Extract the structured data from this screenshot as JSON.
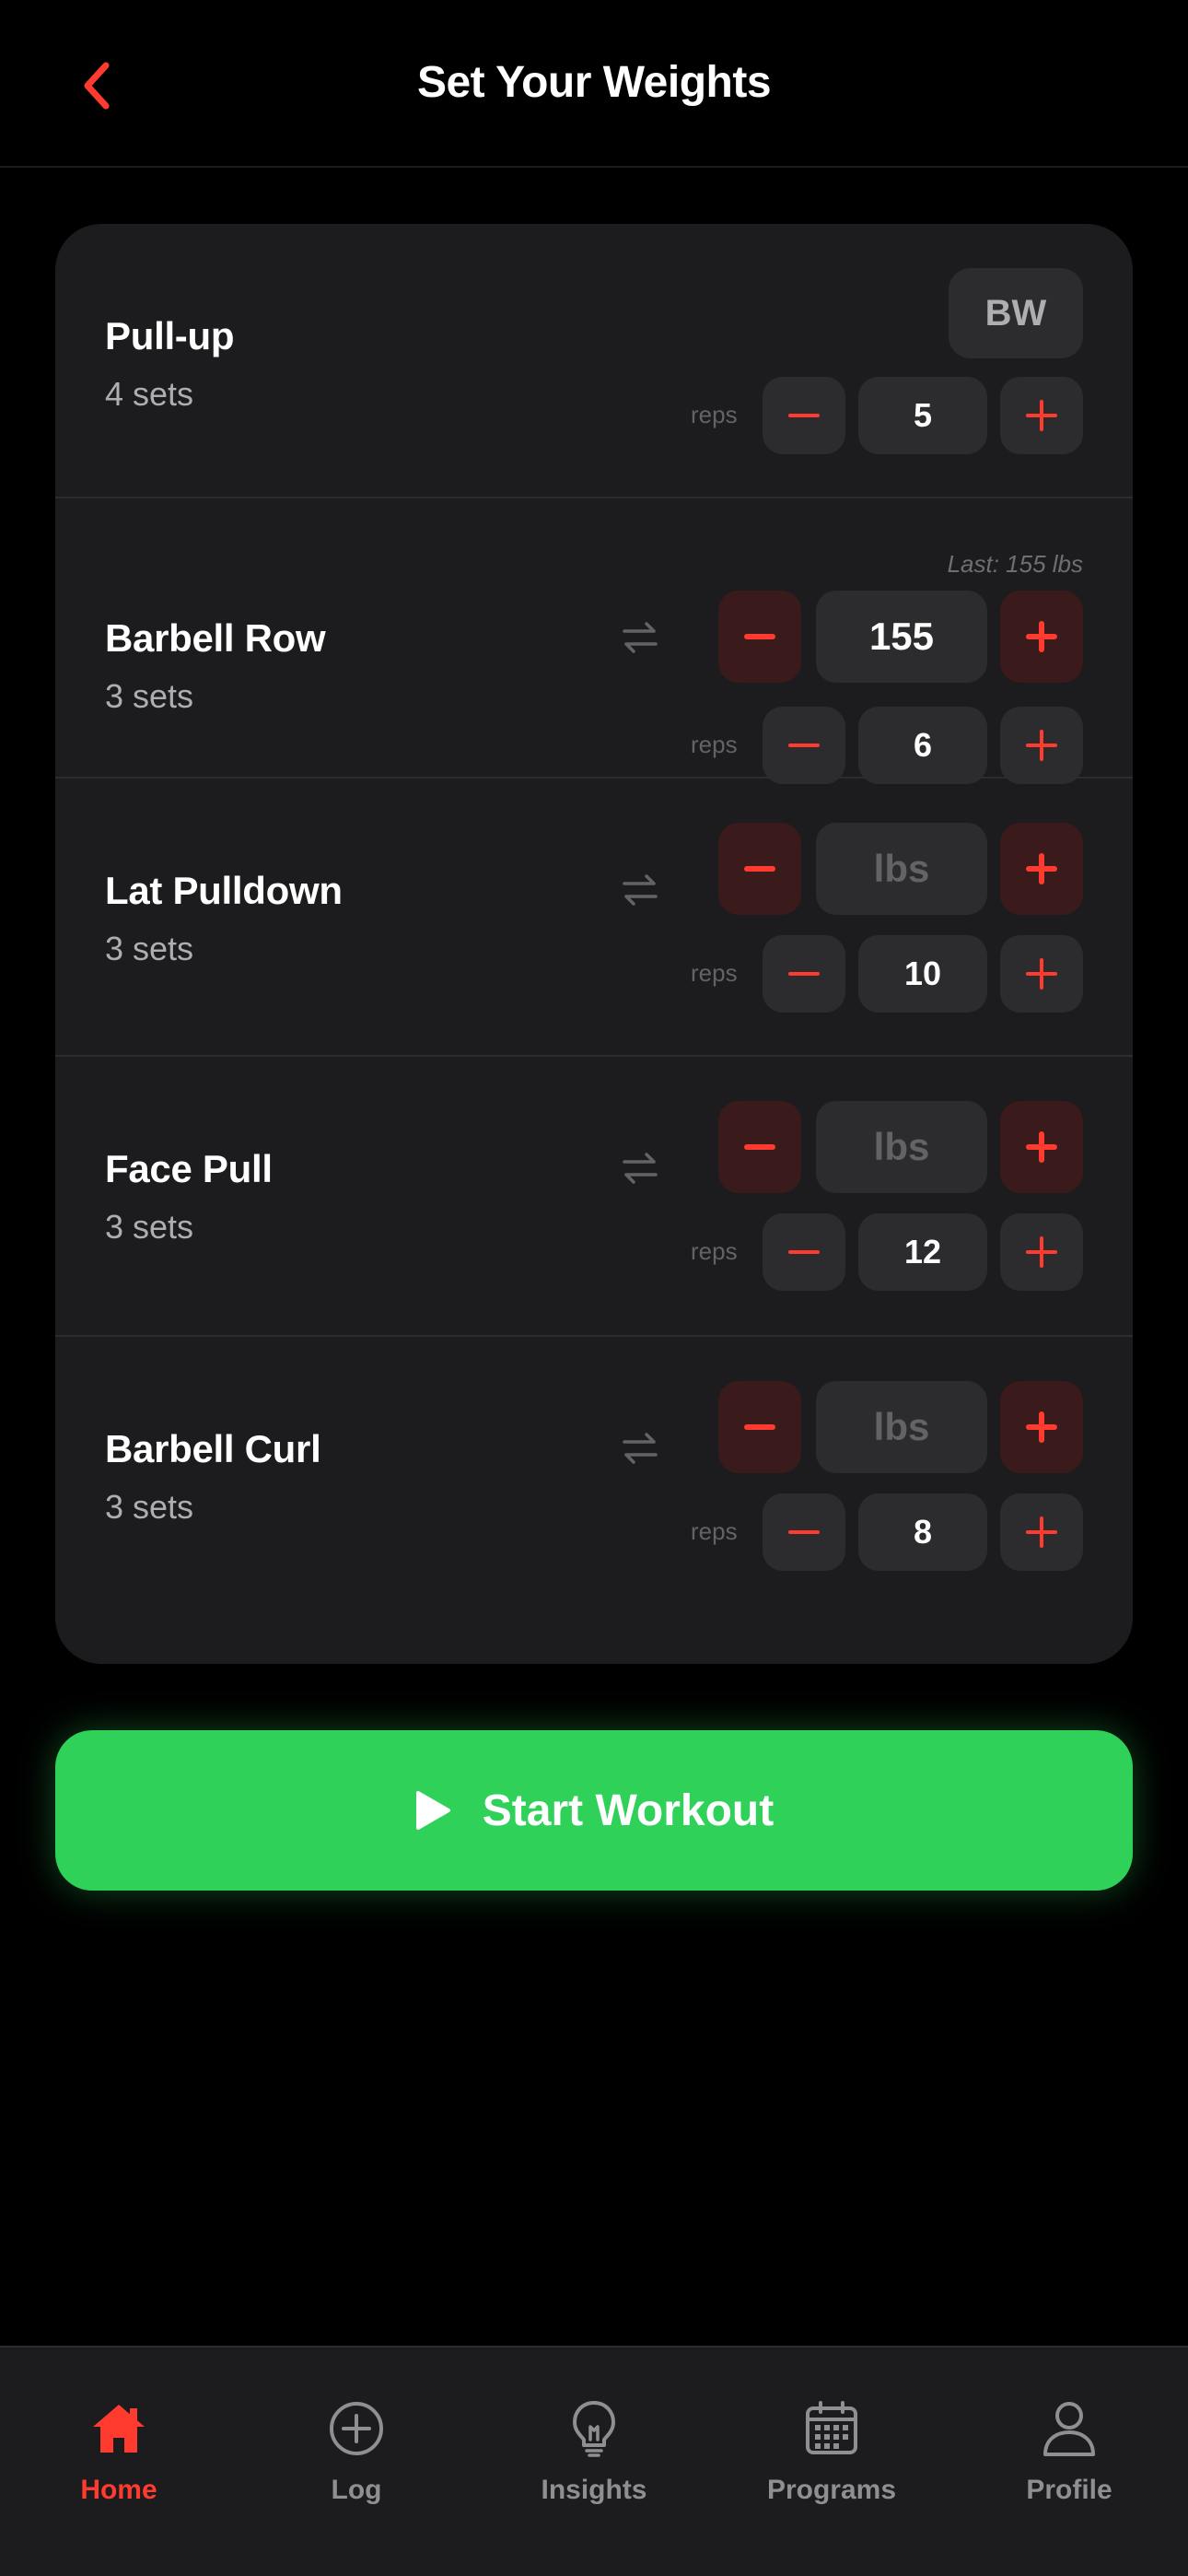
{
  "header": {
    "title": "Set Your Weights"
  },
  "colors": {
    "accent": "#ff3b30",
    "start": "#30d158",
    "card": "#1c1c1e"
  },
  "exercises": [
    {
      "name": "Pull-up",
      "sets": "4 sets",
      "weight": "BW",
      "reps_label": "reps",
      "reps": "5"
    },
    {
      "name": "Barbell Row",
      "sets": "3 sets",
      "last": "Last: 155 lbs",
      "weight": "155",
      "reps_label": "reps",
      "reps": "6"
    },
    {
      "name": "Lat Pulldown",
      "sets": "3 sets",
      "weight_placeholder": "lbs",
      "reps_label": "reps",
      "reps": "10"
    },
    {
      "name": "Face Pull",
      "sets": "3 sets",
      "weight_placeholder": "lbs",
      "reps_label": "reps",
      "reps": "12"
    },
    {
      "name": "Barbell Curl",
      "sets": "3 sets",
      "weight_placeholder": "lbs",
      "reps_label": "reps",
      "reps": "8"
    }
  ],
  "start_button": {
    "label": "Start Workout",
    "icon": "play-icon"
  },
  "tabbar": {
    "items": [
      {
        "label": "Home",
        "icon": "home-icon",
        "active": true
      },
      {
        "label": "Log",
        "icon": "plus-circle-icon",
        "active": false
      },
      {
        "label": "Insights",
        "icon": "lightbulb-icon",
        "active": false
      },
      {
        "label": "Programs",
        "icon": "calendar-icon",
        "active": false
      },
      {
        "label": "Profile",
        "icon": "user-icon",
        "active": false
      }
    ]
  }
}
